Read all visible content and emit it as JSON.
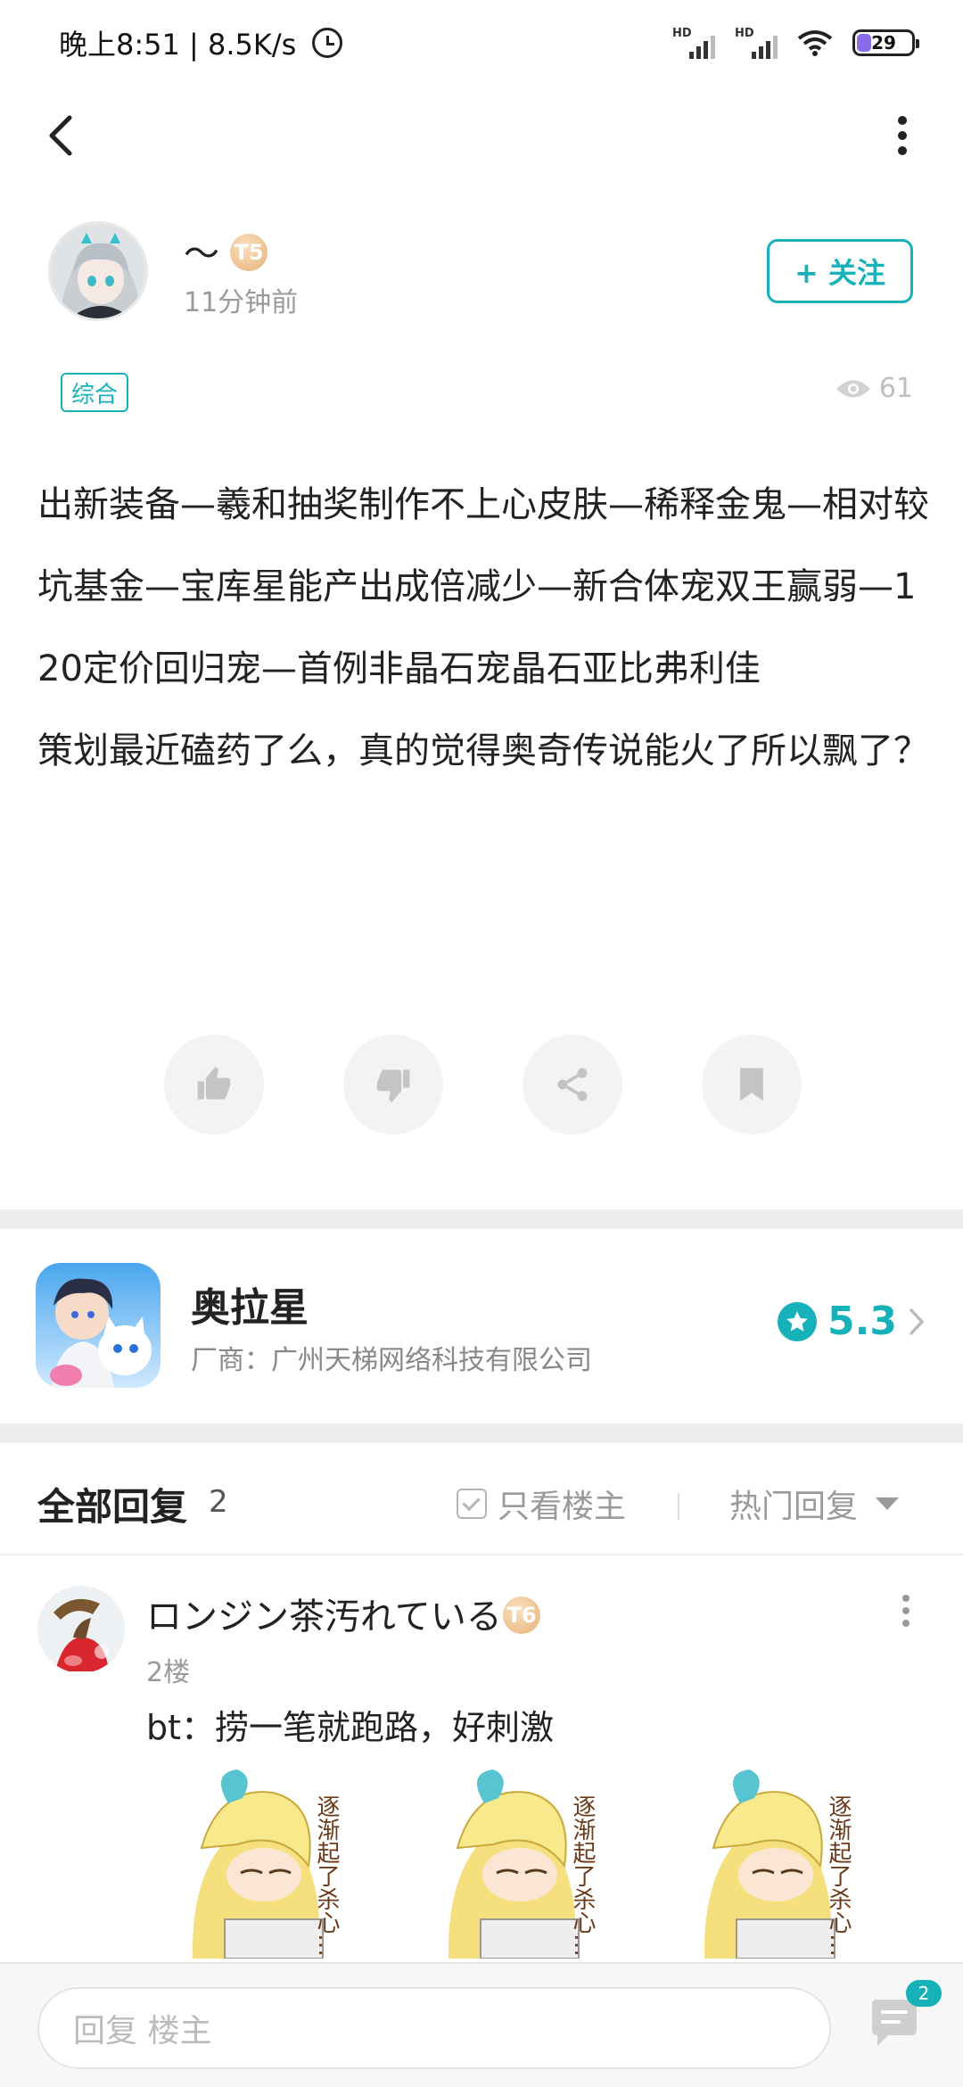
{
  "status_bar": {
    "time_speed": "晚上8:51 | 8.5K/s",
    "network_label_1": "HD",
    "network_label_2": "HD",
    "battery_level": "29"
  },
  "author": {
    "name": "〜",
    "level": "T5",
    "time": "11分钟前",
    "follow_label": "+ 关注"
  },
  "post": {
    "category": "综合",
    "views": "61",
    "body": "出新装备—羲和抽奖制作不上心皮肤—稀释金鬼—相对较坑基金—宝库星能产出成倍减少—新合体宠双王赢弱—120定价回归宠—首例非晶石宠晶石亚比弗利佳\n策划最近磕药了么，真的觉得奥奇传说能火了所以飘了？"
  },
  "actions": [
    {
      "name": "like-button",
      "icon": "thumb-up-icon"
    },
    {
      "name": "dislike-button",
      "icon": "thumb-down-icon"
    },
    {
      "name": "share-button",
      "icon": "share-icon"
    },
    {
      "name": "bookmark-button",
      "icon": "bookmark-icon"
    }
  ],
  "game": {
    "title": "奥拉星",
    "vendor": "厂商：广州天梯网络科技有限公司",
    "rating": "5.3"
  },
  "replies": {
    "title": "全部回复",
    "count": "2",
    "only_op_label": "只看楼主",
    "sort_label": "热门回复",
    "items": [
      {
        "name": "ロンジン茶汚れている",
        "level": "T6",
        "floor": "2楼",
        "text": "bt：捞一笔就跑路，好刺激",
        "sticker_text": "逐渐起了杀心…"
      }
    ]
  },
  "bottom": {
    "reply_placeholder": "回复  楼主",
    "comment_count": "2"
  },
  "colors": {
    "accent": "#16b1b9",
    "divider": "#eeeeee"
  }
}
